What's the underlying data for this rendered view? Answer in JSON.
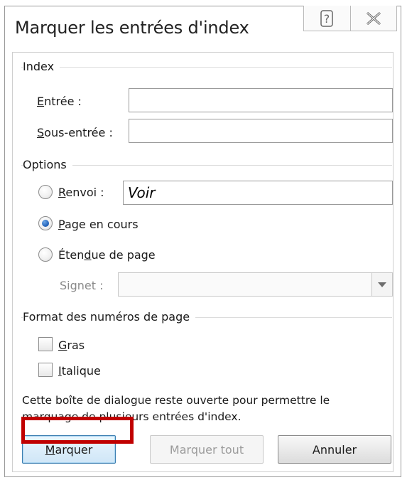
{
  "dialog": {
    "title": "Marquer les entrées d'index",
    "help_icon": "help-icon",
    "close_icon": "close-icon"
  },
  "index": {
    "section_label": "Index",
    "entry_label_u": "E",
    "entry_label_rest": "ntrée :",
    "entry_value": "",
    "subentry_label_u": "S",
    "subentry_label_rest": "ous-entrée :",
    "subentry_value": ""
  },
  "options": {
    "section_label": "Options",
    "renvoi_u": "R",
    "renvoi_rest": "envoi :",
    "renvoi_value": "Voir",
    "page_en_cours_u": "P",
    "page_en_cours_rest": "age en cours",
    "etendue_pre": "Éten",
    "etendue_u": "d",
    "etendue_rest": "ue de page",
    "signet_label": "Signet :",
    "selected": "page_en_cours"
  },
  "format": {
    "section_label": "Format des numéros de page",
    "gras_u": "G",
    "gras_rest": "ras",
    "italique_u": "I",
    "italique_rest": "talique"
  },
  "note": {
    "line1": "Cette boîte de dialogue reste ouverte pour permettre le",
    "line2": "marquage de plusieurs entrées d'index."
  },
  "buttons": {
    "marquer_u": "M",
    "marquer_rest": "arquer",
    "marquer_tout": "Marquer tout",
    "annuler": "Annuler"
  },
  "colors": {
    "highlight": "#c00000",
    "radio_selected": "#1f5fb7"
  }
}
